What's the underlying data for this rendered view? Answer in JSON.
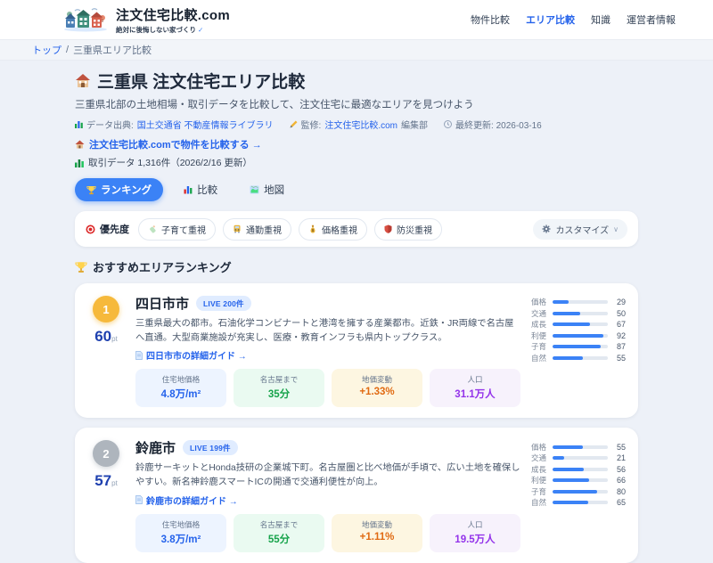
{
  "header": {
    "logo": {
      "title": "注文住宅比較.com",
      "tagline": "絶対に後悔しない家づくり",
      "check": "✓"
    },
    "nav": [
      {
        "label": "物件比較",
        "active": false
      },
      {
        "label": "エリア比較",
        "active": true
      },
      {
        "label": "知識",
        "active": false
      },
      {
        "label": "運営者情報",
        "active": false
      }
    ]
  },
  "breadcrumb": {
    "home": "トップ",
    "separator": "/",
    "current": "三重県エリア比較"
  },
  "page": {
    "title": "三重県 注文住宅エリア比較",
    "subtitle": "三重県北部の土地相場・取引データを比較して、注文住宅に最適なエリアを見つけよう",
    "meta": {
      "source_label": "データ出典:",
      "source_link": "国土交通省 不動産情報ライブラリ",
      "supervisor_label": "監修:",
      "supervisor_link": "注文住宅比較.com",
      "supervisor_suffix": "編集部",
      "updated": "最終更新: 2026-03-16"
    },
    "compare_link": "注文住宅比較.comで物件を比較する →",
    "data_count": "取引データ 1,316件（2026/2/16 更新）"
  },
  "tabs": [
    {
      "icon": "trophy-icon",
      "label": "ランキング",
      "active": true
    },
    {
      "icon": "bar-chart-icon",
      "label": "比較",
      "active": false
    },
    {
      "icon": "map-icon",
      "label": "地図",
      "active": false
    }
  ],
  "filters": {
    "label": "優先度",
    "label_icon": "target-icon",
    "chips": [
      {
        "icon": "baby-bottle-icon",
        "label": "子育て重視"
      },
      {
        "icon": "train-icon",
        "label": "通勤重視"
      },
      {
        "icon": "money-bag-icon",
        "label": "価格重視"
      },
      {
        "icon": "shield-icon",
        "label": "防災重視"
      }
    ],
    "customize": {
      "icon": "gear-icon",
      "label": "カスタマイズ",
      "chevron": "∨"
    }
  },
  "ranking": {
    "heading": "おすすめエリアランキング",
    "heading_icon": "trophy-icon",
    "score_bar_color": "#3b82f6",
    "cards": [
      {
        "rank": "1",
        "points": "60",
        "points_unit": "pt",
        "name": "四日市市",
        "live_badge": "LIVE 200件",
        "description": "三重県最大の都市。石油化学コンビナートと港湾を擁する産業都市。近鉄・JR両線で名古屋へ直通。大型商業施設が充実し、医療・教育インフラも県内トップクラス。",
        "guide_link": "四日市市の詳細ガイド →",
        "stats": [
          {
            "label": "住宅地価格",
            "value": "4.8万/m²",
            "theme": "blue"
          },
          {
            "label": "名古屋まで",
            "value": "35分",
            "theme": "green"
          },
          {
            "label": "地価変動",
            "value": "+1.33%",
            "theme": "orange"
          },
          {
            "label": "人口",
            "value": "31.1万人",
            "theme": "purple"
          }
        ],
        "scores": [
          {
            "label": "価格",
            "value": 29
          },
          {
            "label": "交通",
            "value": 50
          },
          {
            "label": "成長",
            "value": 67
          },
          {
            "label": "利便",
            "value": 92
          },
          {
            "label": "子育",
            "value": 87
          },
          {
            "label": "自然",
            "value": 55
          }
        ]
      },
      {
        "rank": "2",
        "points": "57",
        "points_unit": "pt",
        "name": "鈴鹿市",
        "live_badge": "LIVE 199件",
        "description": "鈴鹿サーキットとHonda技研の企業城下町。名古屋圏と比べ地価が手頃で、広い土地を確保しやすい。新名神鈴鹿スマートICの開通で交通利便性が向上。",
        "guide_link": "鈴鹿市の詳細ガイド →",
        "stats": [
          {
            "label": "住宅地価格",
            "value": "3.8万/m²",
            "theme": "blue"
          },
          {
            "label": "名古屋まで",
            "value": "55分",
            "theme": "green"
          },
          {
            "label": "地価変動",
            "value": "+1.11%",
            "theme": "orange"
          },
          {
            "label": "人口",
            "value": "19.5万人",
            "theme": "purple"
          }
        ],
        "scores": [
          {
            "label": "価格",
            "value": 55
          },
          {
            "label": "交通",
            "value": 21
          },
          {
            "label": "成長",
            "value": 56
          },
          {
            "label": "利便",
            "value": 66
          },
          {
            "label": "子育",
            "value": 80
          },
          {
            "label": "自然",
            "value": 65
          }
        ]
      }
    ]
  },
  "colors": {
    "accent": "#3b82f6",
    "link": "#2563eb",
    "rank_gold": "#f6b93b",
    "rank_silver": "#aeb5bd",
    "stat_blue": "#2563eb",
    "stat_green": "#16a34a",
    "stat_orange": "#e06a12",
    "stat_purple": "#9333ea"
  }
}
